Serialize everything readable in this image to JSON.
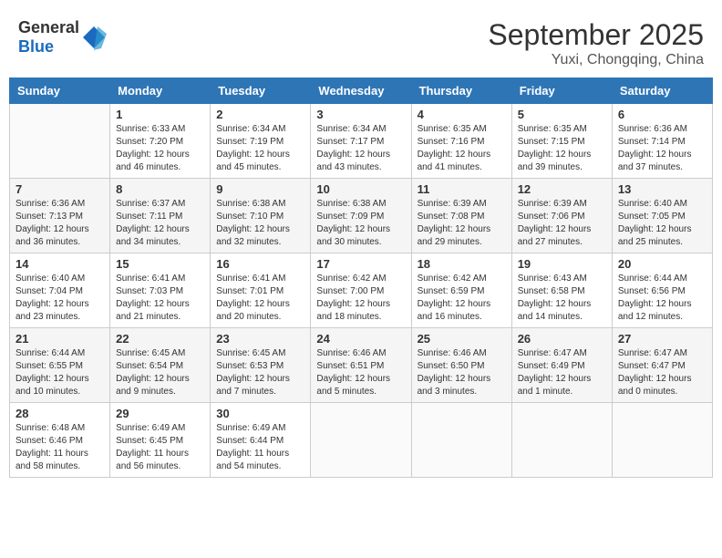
{
  "header": {
    "logo_general": "General",
    "logo_blue": "Blue",
    "month": "September 2025",
    "location": "Yuxi, Chongqing, China"
  },
  "days_of_week": [
    "Sunday",
    "Monday",
    "Tuesday",
    "Wednesday",
    "Thursday",
    "Friday",
    "Saturday"
  ],
  "weeks": [
    [
      {
        "day": "",
        "info": ""
      },
      {
        "day": "1",
        "info": "Sunrise: 6:33 AM\nSunset: 7:20 PM\nDaylight: 12 hours\nand 46 minutes."
      },
      {
        "day": "2",
        "info": "Sunrise: 6:34 AM\nSunset: 7:19 PM\nDaylight: 12 hours\nand 45 minutes."
      },
      {
        "day": "3",
        "info": "Sunrise: 6:34 AM\nSunset: 7:17 PM\nDaylight: 12 hours\nand 43 minutes."
      },
      {
        "day": "4",
        "info": "Sunrise: 6:35 AM\nSunset: 7:16 PM\nDaylight: 12 hours\nand 41 minutes."
      },
      {
        "day": "5",
        "info": "Sunrise: 6:35 AM\nSunset: 7:15 PM\nDaylight: 12 hours\nand 39 minutes."
      },
      {
        "day": "6",
        "info": "Sunrise: 6:36 AM\nSunset: 7:14 PM\nDaylight: 12 hours\nand 37 minutes."
      }
    ],
    [
      {
        "day": "7",
        "info": "Sunrise: 6:36 AM\nSunset: 7:13 PM\nDaylight: 12 hours\nand 36 minutes."
      },
      {
        "day": "8",
        "info": "Sunrise: 6:37 AM\nSunset: 7:11 PM\nDaylight: 12 hours\nand 34 minutes."
      },
      {
        "day": "9",
        "info": "Sunrise: 6:38 AM\nSunset: 7:10 PM\nDaylight: 12 hours\nand 32 minutes."
      },
      {
        "day": "10",
        "info": "Sunrise: 6:38 AM\nSunset: 7:09 PM\nDaylight: 12 hours\nand 30 minutes."
      },
      {
        "day": "11",
        "info": "Sunrise: 6:39 AM\nSunset: 7:08 PM\nDaylight: 12 hours\nand 29 minutes."
      },
      {
        "day": "12",
        "info": "Sunrise: 6:39 AM\nSunset: 7:06 PM\nDaylight: 12 hours\nand 27 minutes."
      },
      {
        "day": "13",
        "info": "Sunrise: 6:40 AM\nSunset: 7:05 PM\nDaylight: 12 hours\nand 25 minutes."
      }
    ],
    [
      {
        "day": "14",
        "info": "Sunrise: 6:40 AM\nSunset: 7:04 PM\nDaylight: 12 hours\nand 23 minutes."
      },
      {
        "day": "15",
        "info": "Sunrise: 6:41 AM\nSunset: 7:03 PM\nDaylight: 12 hours\nand 21 minutes."
      },
      {
        "day": "16",
        "info": "Sunrise: 6:41 AM\nSunset: 7:01 PM\nDaylight: 12 hours\nand 20 minutes."
      },
      {
        "day": "17",
        "info": "Sunrise: 6:42 AM\nSunset: 7:00 PM\nDaylight: 12 hours\nand 18 minutes."
      },
      {
        "day": "18",
        "info": "Sunrise: 6:42 AM\nSunset: 6:59 PM\nDaylight: 12 hours\nand 16 minutes."
      },
      {
        "day": "19",
        "info": "Sunrise: 6:43 AM\nSunset: 6:58 PM\nDaylight: 12 hours\nand 14 minutes."
      },
      {
        "day": "20",
        "info": "Sunrise: 6:44 AM\nSunset: 6:56 PM\nDaylight: 12 hours\nand 12 minutes."
      }
    ],
    [
      {
        "day": "21",
        "info": "Sunrise: 6:44 AM\nSunset: 6:55 PM\nDaylight: 12 hours\nand 10 minutes."
      },
      {
        "day": "22",
        "info": "Sunrise: 6:45 AM\nSunset: 6:54 PM\nDaylight: 12 hours\nand 9 minutes."
      },
      {
        "day": "23",
        "info": "Sunrise: 6:45 AM\nSunset: 6:53 PM\nDaylight: 12 hours\nand 7 minutes."
      },
      {
        "day": "24",
        "info": "Sunrise: 6:46 AM\nSunset: 6:51 PM\nDaylight: 12 hours\nand 5 minutes."
      },
      {
        "day": "25",
        "info": "Sunrise: 6:46 AM\nSunset: 6:50 PM\nDaylight: 12 hours\nand 3 minutes."
      },
      {
        "day": "26",
        "info": "Sunrise: 6:47 AM\nSunset: 6:49 PM\nDaylight: 12 hours\nand 1 minute."
      },
      {
        "day": "27",
        "info": "Sunrise: 6:47 AM\nSunset: 6:47 PM\nDaylight: 12 hours\nand 0 minutes."
      }
    ],
    [
      {
        "day": "28",
        "info": "Sunrise: 6:48 AM\nSunset: 6:46 PM\nDaylight: 11 hours\nand 58 minutes."
      },
      {
        "day": "29",
        "info": "Sunrise: 6:49 AM\nSunset: 6:45 PM\nDaylight: 11 hours\nand 56 minutes."
      },
      {
        "day": "30",
        "info": "Sunrise: 6:49 AM\nSunset: 6:44 PM\nDaylight: 11 hours\nand 54 minutes."
      },
      {
        "day": "",
        "info": ""
      },
      {
        "day": "",
        "info": ""
      },
      {
        "day": "",
        "info": ""
      },
      {
        "day": "",
        "info": ""
      }
    ]
  ]
}
